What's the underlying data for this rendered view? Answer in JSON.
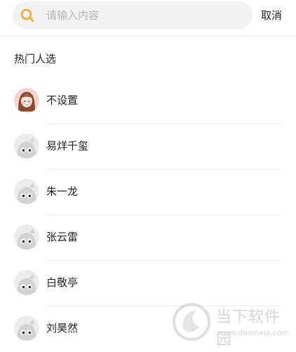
{
  "search": {
    "placeholder": "请输入内容",
    "cancel_label": "取消",
    "icon": "search-icon",
    "icon_color": "#f5a623"
  },
  "section": {
    "title": "热门人选"
  },
  "list": {
    "items": [
      {
        "label": "不设置",
        "avatar": "girl-avatar-icon"
      },
      {
        "label": "易烊千玺",
        "avatar": "default-avatar-icon"
      },
      {
        "label": "朱一龙",
        "avatar": "default-avatar-icon"
      },
      {
        "label": "张云雷",
        "avatar": "default-avatar-icon"
      },
      {
        "label": "白敬亭",
        "avatar": "default-avatar-icon"
      },
      {
        "label": "刘昊然",
        "avatar": "default-avatar-icon"
      }
    ]
  },
  "watermark": {
    "title": "当下软件园",
    "url": "www.downxia.com"
  }
}
